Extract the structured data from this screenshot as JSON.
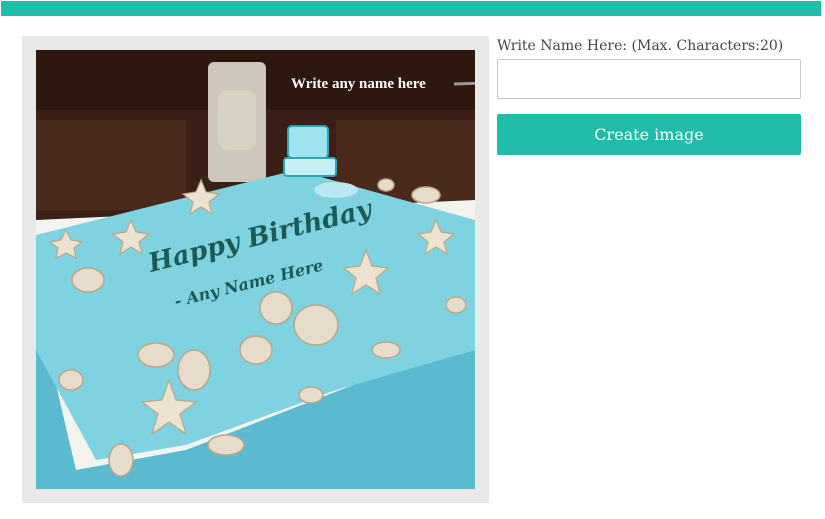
{
  "colors": {
    "accent": "#1fbca7",
    "cake_icing": "#7fd3e0",
    "cake_text": "#1e5a55",
    "wood": "#3a2016",
    "tablecloth": "#f4f4ef"
  },
  "preview": {
    "hint_text": "Write any name here",
    "cake_line_1": "Happy Birthday",
    "cake_line_2": "- Any Name Here"
  },
  "form": {
    "label": "Write Name Here: (Max. Characters:20)",
    "input_value": "",
    "input_placeholder": "",
    "button_label": "Create image"
  }
}
